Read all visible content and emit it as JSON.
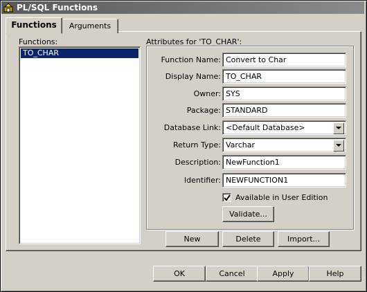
{
  "window": {
    "title": "PL/SQL Functions"
  },
  "tabs": [
    {
      "label": "Functions"
    },
    {
      "label": "Arguments"
    }
  ],
  "functions_list": {
    "label": "Functions:",
    "items": [
      "TO_CHAR"
    ],
    "selected": "TO_CHAR"
  },
  "attributes": {
    "group_label": "Attributes for 'TO_CHAR':",
    "function_name": {
      "label": "Function Name:",
      "value": "Convert to Char"
    },
    "display_name": {
      "label": "Display Name:",
      "value": "TO_CHAR"
    },
    "owner": {
      "label": "Owner:",
      "value": "SYS"
    },
    "package": {
      "label": "Package:",
      "value": "STANDARD"
    },
    "database_link": {
      "label": "Database Link:",
      "value": "<Default Database>"
    },
    "return_type": {
      "label": "Return Type:",
      "value": "Varchar"
    },
    "description": {
      "label": "Description:",
      "value": "NewFunction1"
    },
    "identifier": {
      "label": "Identifier:",
      "value": "NEWFUNCTION1"
    },
    "available_checkbox": {
      "label": "Available in User Edition",
      "checked": true
    },
    "validate_button": "Validate..."
  },
  "list_buttons": {
    "new": "New",
    "delete": "Delete",
    "import": "Import..."
  },
  "dialog_buttons": {
    "ok": "OK",
    "cancel": "Cancel",
    "apply": "Apply",
    "help": "Help"
  },
  "colors": {
    "face": "#d4d0c8",
    "selection": "#0a246a",
    "titlebar": "#6b6b6b"
  },
  "icons": [
    "window-app-icon",
    "checkmark-icon",
    "dropdown-arrow-icon"
  ]
}
